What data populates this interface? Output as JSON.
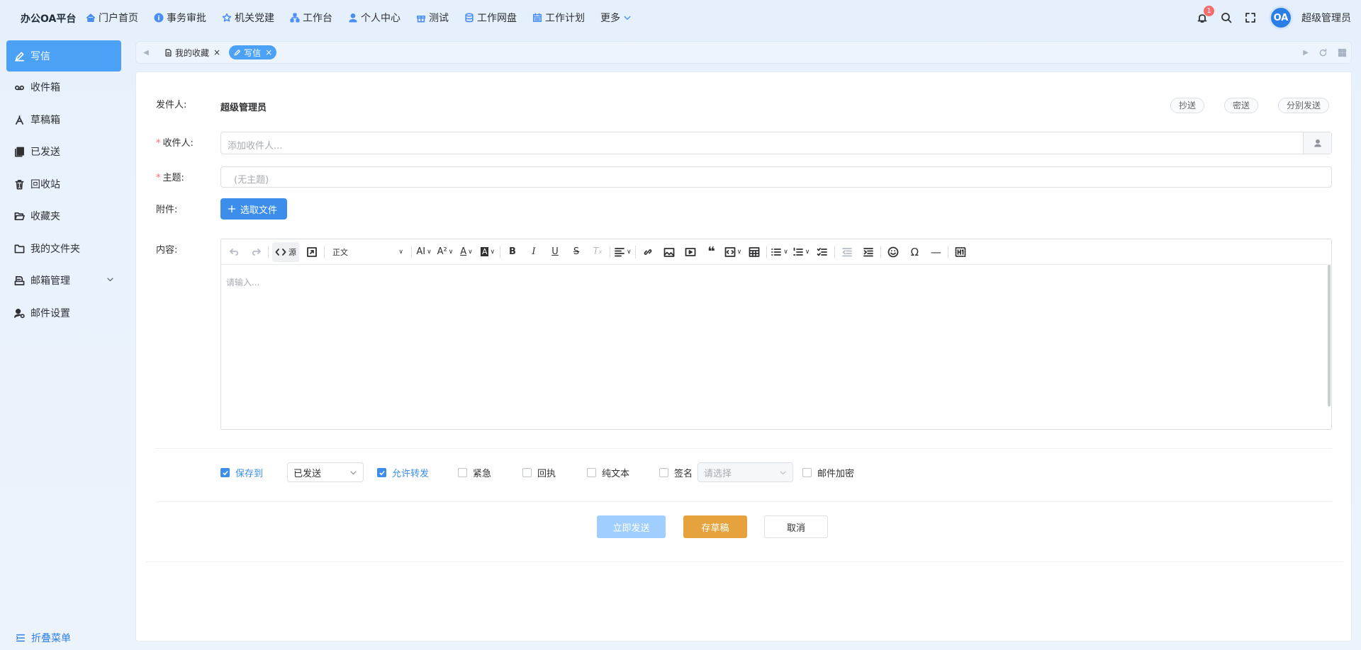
{
  "app": {
    "title": "办公OA平台"
  },
  "topnav": [
    {
      "label": "门户首页",
      "icon": "home-icon"
    },
    {
      "label": "事务审批",
      "icon": "info-icon"
    },
    {
      "label": "机关党建",
      "icon": "star-icon"
    },
    {
      "label": "工作台",
      "icon": "org-chart-icon"
    },
    {
      "label": "个人中心",
      "icon": "user-icon"
    },
    {
      "label": "测试",
      "icon": "gift-icon"
    },
    {
      "label": "工作网盘",
      "icon": "database-icon"
    },
    {
      "label": "工作计划",
      "icon": "calendar-icon"
    },
    {
      "label": "更多",
      "icon": "chevron-down-icon"
    }
  ],
  "header": {
    "notification_count": "1",
    "avatar_text": "OA",
    "username": "超级管理员"
  },
  "sidebar": {
    "items": [
      {
        "label": "写信",
        "icon": "edit-icon",
        "active": true
      },
      {
        "label": "收件箱",
        "icon": "voicemail-icon"
      },
      {
        "label": "草稿箱",
        "icon": "draft-icon"
      },
      {
        "label": "已发送",
        "icon": "sent-icon"
      },
      {
        "label": "回收站",
        "icon": "trash-icon"
      },
      {
        "label": "收藏夹",
        "icon": "folder-open-icon"
      },
      {
        "label": "我的文件夹",
        "icon": "folder-icon"
      },
      {
        "label": "邮箱管理",
        "icon": "mailbox-icon"
      },
      {
        "label": "邮件设置",
        "icon": "user-settings-icon"
      }
    ],
    "collapse_label": "折叠菜单"
  },
  "tabs": [
    {
      "label": "我的收藏",
      "active": false
    },
    {
      "label": "写信",
      "active": true
    }
  ],
  "form": {
    "sender_label": "发件人:",
    "sender_value": "超级管理员",
    "cc_label": "抄送",
    "bcc_label": "密送",
    "separate_label": "分别发送",
    "recipient_label": "收件人:",
    "recipient_placeholder": "添加收件人...",
    "subject_label": "主题:",
    "subject_placeholder": "(无主题)",
    "attachment_label": "附件:",
    "attachment_button": "选取文件",
    "content_label": "内容:",
    "content_placeholder": "请输入...",
    "toolbar": {
      "source_label": "源",
      "paragraph_select": "正文"
    }
  },
  "options": {
    "save_to_label": "保存到",
    "save_to_checked": true,
    "save_to_value": "已发送",
    "allow_forward_label": "允许转发",
    "allow_forward_checked": true,
    "urgent_label": "紧急",
    "receipt_label": "回执",
    "plain_text_label": "纯文本",
    "signature_label": "签名",
    "signature_placeholder": "请选择",
    "encrypt_label": "邮件加密"
  },
  "actions": {
    "send_label": "立即发送",
    "draft_label": "存草稿",
    "cancel_label": "取消"
  },
  "colors": {
    "primary": "#3d8eea",
    "active_menu": "#4aa1f6",
    "draft_button": "#e6a23c",
    "send_disabled": "#a0cfff",
    "required": "#f56c6c"
  }
}
